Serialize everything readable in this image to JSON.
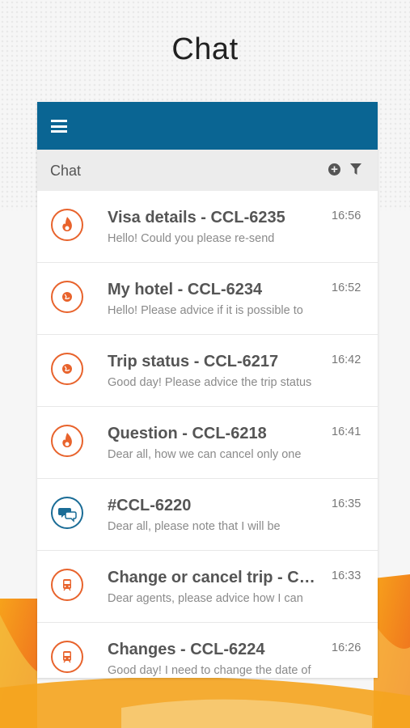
{
  "page": {
    "title": "Chat"
  },
  "toolbar": {
    "section_label": "Chat",
    "menu_icon": "hamburger-menu-icon",
    "add_icon": "add-circle-icon",
    "filter_icon": "filter-icon"
  },
  "colors": {
    "brand_blue": "#0a6593",
    "accent_orange": "#e8632c",
    "icon_blue": "#1a6c96"
  },
  "chats": [
    {
      "title": "Visa details - CCL-6235",
      "preview": "Hello! Could you please re-send",
      "time": "16:56",
      "icon": "fire-icon",
      "color": "orange"
    },
    {
      "title": "My hotel - CCL-6234",
      "preview": "Hello! Please advice if it is possible to",
      "time": "16:52",
      "icon": "globe-icon",
      "color": "orange"
    },
    {
      "title": "Trip status - CCL-6217",
      "preview": "Good day! Please advice the trip status",
      "time": "16:42",
      "icon": "globe-icon",
      "color": "orange"
    },
    {
      "title": "Question - CCL-6218",
      "preview": "Dear all, how we can cancel only one",
      "time": "16:41",
      "icon": "fire-icon",
      "color": "orange"
    },
    {
      "title": "#CCL-6220",
      "preview": "Dear all, please note that I will be",
      "time": "16:35",
      "icon": "chat-bubbles-icon",
      "color": "blue"
    },
    {
      "title": "Change or cancel trip - CC...",
      "preview": "Dear agents, please advice how I can",
      "time": "16:33",
      "icon": "train-icon",
      "color": "orange"
    },
    {
      "title": "Changes - CCL-6224",
      "preview": "Good day! I need to change the date of",
      "time": "16:26",
      "icon": "train-icon",
      "color": "orange"
    }
  ]
}
